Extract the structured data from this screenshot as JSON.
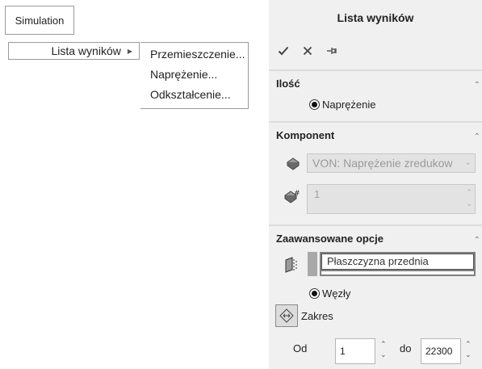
{
  "menu": {
    "root_label": "Simulation",
    "submenu_label": "Lista wyników",
    "flyout_items": [
      "Przemieszczenie...",
      "Naprężenie...",
      "Odkształcenie..."
    ]
  },
  "panel": {
    "title": "Lista wyników",
    "actions": {
      "ok": "check-icon",
      "cancel": "close-icon",
      "pin": "pin-icon"
    },
    "sections": {
      "ilosc": {
        "title": "Ilość",
        "radio_label": "Naprężenie"
      },
      "komponent": {
        "title": "Komponent",
        "component_value": "VON: Naprężenie zredukow",
        "count_value": "1"
      },
      "zaawansowane": {
        "title": "Zaawansowane opcje",
        "plane_value": "Płaszczyzna przednia",
        "nodes_label": "Węzły",
        "range_label": "Zakres",
        "from_label": "Od",
        "from_value": "1",
        "to_label": "do",
        "to_value": "22300"
      }
    }
  }
}
